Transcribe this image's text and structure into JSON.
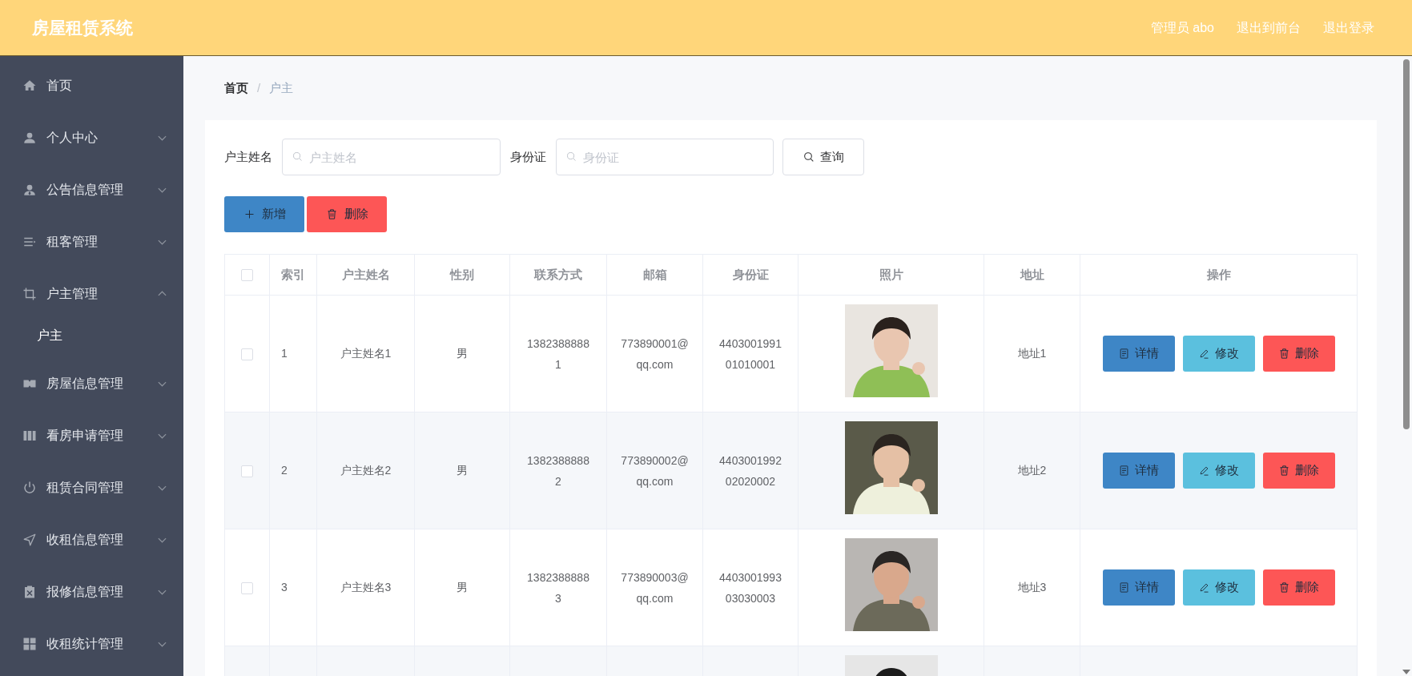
{
  "header": {
    "title": "房屋租赁系统",
    "links": [
      "管理员 abo",
      "退出到前台",
      "退出登录"
    ]
  },
  "sidebar": {
    "items": [
      {
        "label": "首页",
        "expandable": false
      },
      {
        "label": "个人中心",
        "expandable": true,
        "expanded": false
      },
      {
        "label": "公告信息管理",
        "expandable": true,
        "expanded": false
      },
      {
        "label": "租客管理",
        "expandable": true,
        "expanded": false
      },
      {
        "label": "户主管理",
        "expandable": true,
        "expanded": true,
        "children": [
          {
            "label": "户主",
            "selected": true
          }
        ]
      },
      {
        "label": "房屋信息管理",
        "expandable": true,
        "expanded": false
      },
      {
        "label": "看房申请管理",
        "expandable": true,
        "expanded": false
      },
      {
        "label": "租赁合同管理",
        "expandable": true,
        "expanded": false
      },
      {
        "label": "收租信息管理",
        "expandable": true,
        "expanded": false
      },
      {
        "label": "报修信息管理",
        "expandable": true,
        "expanded": false
      },
      {
        "label": "收租统计管理",
        "expandable": true,
        "expanded": false
      }
    ]
  },
  "breadcrumb": {
    "items": [
      "首页",
      "户主"
    ],
    "separator": "/"
  },
  "search": {
    "fields": [
      {
        "label": "户主姓名",
        "placeholder": "户主姓名"
      },
      {
        "label": "身份证",
        "placeholder": "身份证"
      }
    ],
    "button": "查询"
  },
  "actions": {
    "add": "新增",
    "delete": "删除"
  },
  "table": {
    "select_all": {
      "checked": false
    },
    "columns": [
      "索引",
      "户主姓名",
      "性别",
      "联系方式",
      "邮箱",
      "身份证",
      "照片",
      "地址",
      "操作"
    ],
    "rows": [
      {
        "checked": false,
        "index": "1",
        "name": "户主姓名1",
        "gender": "男",
        "phone": "13823888881",
        "email": "773890001@qq.com",
        "id_card": "440300199101010001",
        "photo": {
          "kind": "picture"
        },
        "address": "地址1",
        "buttons": [
          "详情",
          "修改",
          "删除"
        ]
      },
      {
        "checked": false,
        "index": "2",
        "name": "户主姓名2",
        "gender": "男",
        "phone": "13823888882",
        "email": "773890002@qq.com",
        "id_card": "440300199202020002",
        "photo": {
          "kind": "picture"
        },
        "address": "地址2",
        "buttons": [
          "详情",
          "修改",
          "删除"
        ]
      },
      {
        "checked": false,
        "index": "3",
        "name": "户主姓名3",
        "gender": "男",
        "phone": "13823888883",
        "email": "773890003@qq.com",
        "id_card": "440300199303030003",
        "photo": {
          "kind": "picture"
        },
        "address": "地址3",
        "buttons": [
          "详情",
          "修改",
          "删除"
        ]
      },
      {
        "photo": {
          "kind": "picture"
        }
      }
    ]
  }
}
